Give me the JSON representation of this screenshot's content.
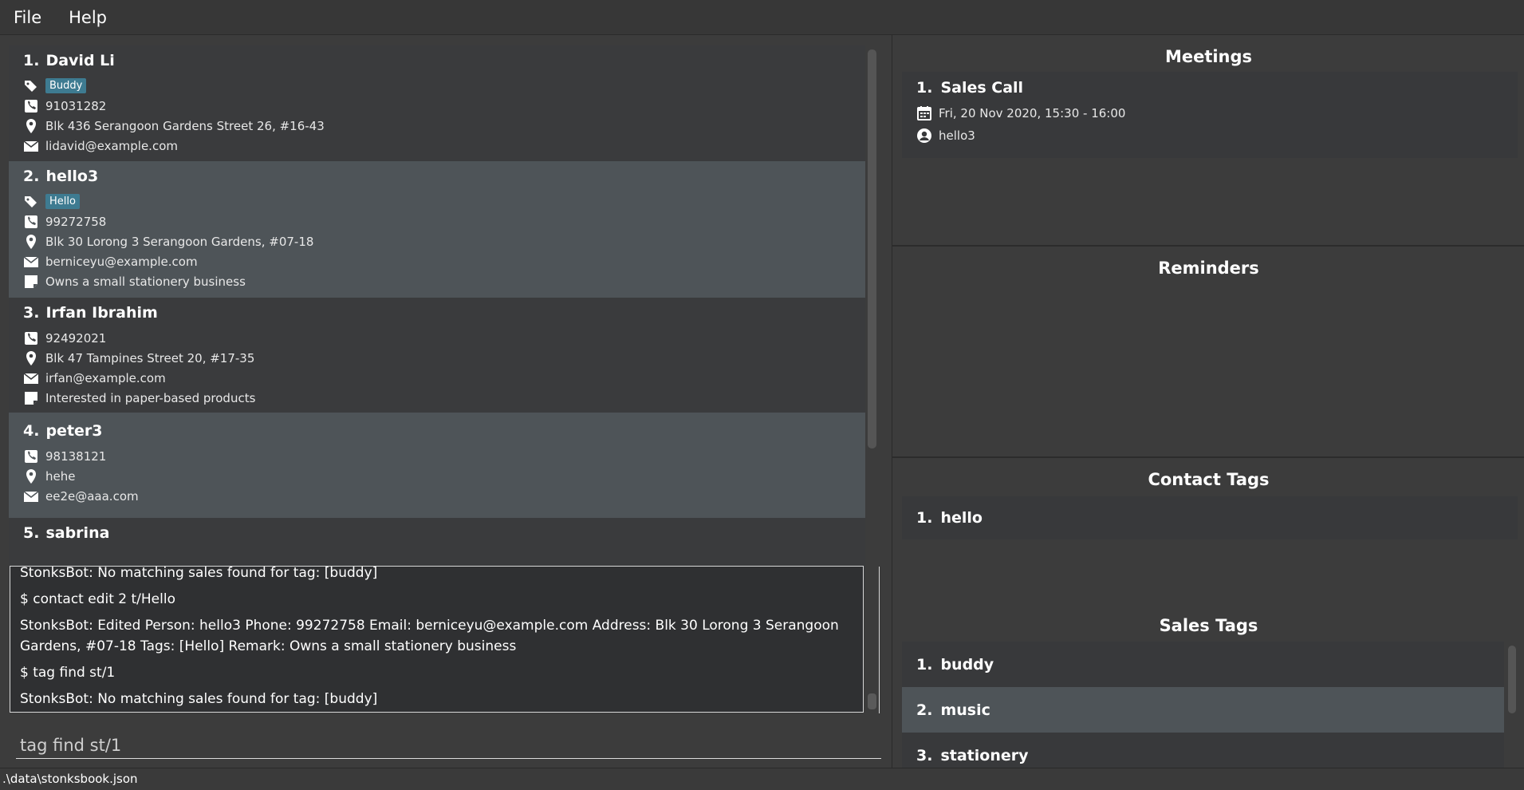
{
  "menu": [
    "File",
    "Help"
  ],
  "persons": [
    {
      "index": "1.",
      "name": "David Li",
      "tag": "Buddy",
      "phone": "91031282",
      "address": "Blk 436 Serangoon Gardens Street 26, #16-43",
      "email": "lidavid@example.com",
      "remark": ""
    },
    {
      "index": "2.",
      "name": "hello3",
      "tag": "Hello",
      "phone": "99272758",
      "address": "Blk 30 Lorong 3 Serangoon Gardens, #07-18",
      "email": "berniceyu@example.com",
      "remark": "Owns a small stationery business"
    },
    {
      "index": "3.",
      "name": "Irfan Ibrahim",
      "tag": "",
      "phone": "92492021",
      "address": "Blk 47 Tampines Street 20, #17-35",
      "email": "irfan@example.com",
      "remark": "Interested in paper-based products"
    },
    {
      "index": "4.",
      "name": "peter3",
      "tag": "",
      "phone": "98138121",
      "address": "hehe",
      "email": "ee2e@aaa.com",
      "remark": ""
    },
    {
      "index": "5.",
      "name": "sabrina"
    }
  ],
  "result_lines": [
    "StonksBot: No matching sales found for tag: [buddy]",
    "$ contact edit 2 t/Hello",
    "StonksBot: Edited Person: hello3 Phone: 99272758 Email: berniceyu@example.com Address: Blk 30 Lorong 3 Serangoon Gardens, #07-18 Tags: [Hello] Remark: Owns a small stationery business",
    "$ tag find st/1",
    "StonksBot: No matching sales found for tag: [buddy]"
  ],
  "command": {
    "value": "tag find st/1"
  },
  "meetings": {
    "title": "Meetings",
    "items": [
      {
        "index": "1.",
        "name": "Sales Call",
        "datetime": "Fri, 20 Nov 2020, 15:30 - 16:00",
        "contact": "hello3"
      }
    ]
  },
  "reminders": {
    "title": "Reminders"
  },
  "contact_tags": {
    "title": "Contact Tags",
    "items": [
      {
        "index": "1.",
        "name": "hello"
      }
    ]
  },
  "sales_tags": {
    "title": "Sales Tags",
    "items": [
      {
        "index": "1.",
        "name": "buddy"
      },
      {
        "index": "2.",
        "name": "music"
      },
      {
        "index": "3.",
        "name": "stationery"
      }
    ]
  },
  "status": {
    "path": ".\\data\\stonksbook.json"
  },
  "colors": {
    "background": "#3c3c3c",
    "card": "#3a3b3d",
    "card_selected": "#4e5458",
    "tag": "#3e7b91"
  }
}
